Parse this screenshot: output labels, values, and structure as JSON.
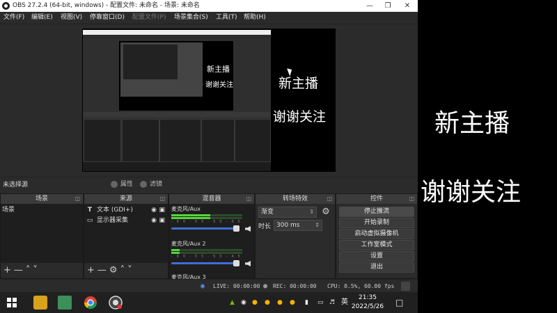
{
  "window": {
    "title": "OBS 27.2.4 (64-bit, windows) - 配置文件: 未命名 - 场景: 未命名"
  },
  "menu": [
    "文件(F)",
    "编辑(E)",
    "视图(V)",
    "停靠窗口(D)",
    "配置文件(P)",
    "场景集合(S)",
    "工具(T)",
    "帮助(H)"
  ],
  "preview": {
    "line1": "新主播",
    "line2": "谢谢关注"
  },
  "source_toolbar": {
    "no_selection": "未选择源",
    "properties": "属性",
    "filters": "滤镜"
  },
  "docks": {
    "scenes": {
      "title": "场景",
      "items": [
        "场景"
      ]
    },
    "sources": {
      "title": "来源",
      "items": [
        {
          "icon": "text-icon",
          "label": "文本 (GDI+)"
        },
        {
          "icon": "monitor-icon",
          "label": "显示器采集"
        }
      ]
    },
    "mixer": {
      "title": "混音器",
      "channels": [
        {
          "name": "麦克风/Aux",
          "level": 0.55,
          "volume": 0.95
        },
        {
          "name": "麦克风/Aux 2",
          "level": 0.12,
          "volume": 0.95
        },
        {
          "name": "麦克风/Aux 3"
        }
      ]
    },
    "transitions": {
      "title": "转场特效",
      "selected": "渐变",
      "duration_label": "时长",
      "duration_value": "300 ms"
    },
    "controls": {
      "title": "控件",
      "buttons": [
        "停止推流",
        "开始录制",
        "启动虚拟摄像机",
        "工作室模式",
        "设置",
        "退出"
      ]
    }
  },
  "status": {
    "live": "LIVE: 00:00:00",
    "rec": "REC: 00:00:00",
    "cpu": "CPU: 0.5%, 60.00 fps"
  },
  "taskbar": {
    "time": "21:35",
    "date": "2022/5/26",
    "ime": "英"
  },
  "overlay": {
    "line1": "新主播",
    "line2": "谢谢关注"
  }
}
